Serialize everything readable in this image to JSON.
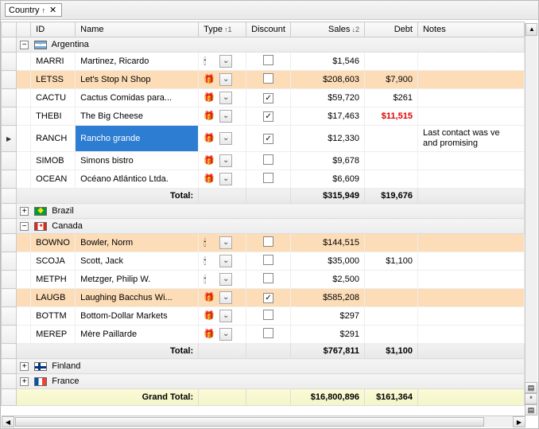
{
  "group_chip": {
    "label": "Country",
    "sort": "↑",
    "close": "✕"
  },
  "columns": {
    "id": "ID",
    "name": "Name",
    "type": "Type",
    "type_sort": "↑1",
    "discount": "Discount",
    "sales": "Sales",
    "sales_sort": "↓2",
    "debt": "Debt",
    "notes": "Notes"
  },
  "groups": [
    {
      "expanded": true,
      "flag": "ar",
      "country": "Argentina",
      "rows": [
        {
          "highlight": false,
          "selected": false,
          "indicator": false,
          "id": "MARRI",
          "name": "Martinez, Ricardo",
          "type": "single",
          "discount": false,
          "sales": "$1,546",
          "debt": "",
          "notes": "",
          "debt_red": false
        },
        {
          "highlight": true,
          "selected": false,
          "indicator": false,
          "id": "LETSS",
          "name": "Let's Stop N Shop",
          "type": "double",
          "discount": false,
          "sales": "$208,603",
          "debt": "$7,900",
          "notes": "",
          "debt_red": false
        },
        {
          "highlight": false,
          "selected": false,
          "indicator": false,
          "id": "CACTU",
          "name": "Cactus Comidas para...",
          "type": "double",
          "discount": true,
          "sales": "$59,720",
          "debt": "$261",
          "notes": "",
          "debt_red": false
        },
        {
          "highlight": false,
          "selected": false,
          "indicator": false,
          "id": "THEBI",
          "name": "The Big Cheese",
          "type": "double",
          "discount": true,
          "sales": "$17,463",
          "debt": "$11,515",
          "notes": "",
          "debt_red": true
        },
        {
          "highlight": false,
          "selected": true,
          "indicator": true,
          "id": "RANCH",
          "name": "Rancho grande",
          "type": "double",
          "discount": true,
          "sales": "$12,330",
          "debt": "",
          "notes": "Last contact was ve\nand promising",
          "debt_red": false
        },
        {
          "highlight": false,
          "selected": false,
          "indicator": false,
          "id": "SIMOB",
          "name": "Simons bistro",
          "type": "double",
          "discount": false,
          "sales": "$9,678",
          "debt": "",
          "notes": "",
          "debt_red": false
        },
        {
          "highlight": false,
          "selected": false,
          "indicator": false,
          "id": "OCEAN",
          "name": "Océano Atlántico Ltda.",
          "type": "double",
          "discount": false,
          "sales": "$6,609",
          "debt": "",
          "notes": "",
          "debt_red": false
        }
      ],
      "total": {
        "label": "Total:",
        "sales": "$315,949",
        "debt": "$19,676"
      }
    },
    {
      "expanded": false,
      "flag": "br",
      "country": "Brazil",
      "rows": [],
      "total": null
    },
    {
      "expanded": true,
      "flag": "ca",
      "country": "Canada",
      "rows": [
        {
          "highlight": true,
          "selected": false,
          "indicator": false,
          "id": "BOWNO",
          "name": "Bowler, Norm",
          "type": "single",
          "discount": false,
          "sales": "$144,515",
          "debt": "",
          "notes": "",
          "debt_red": false
        },
        {
          "highlight": false,
          "selected": false,
          "indicator": false,
          "id": "SCOJA",
          "name": "Scott, Jack",
          "type": "single",
          "discount": false,
          "sales": "$35,000",
          "debt": "$1,100",
          "notes": "",
          "debt_red": false
        },
        {
          "highlight": false,
          "selected": false,
          "indicator": false,
          "id": "METPH",
          "name": "Metzger, Philip W.",
          "type": "single",
          "discount": false,
          "sales": "$2,500",
          "debt": "",
          "notes": "",
          "debt_red": false
        },
        {
          "highlight": true,
          "selected": false,
          "indicator": false,
          "id": "LAUGB",
          "name": "Laughing Bacchus Wi...",
          "type": "double",
          "discount": true,
          "sales": "$585,208",
          "debt": "",
          "notes": "",
          "debt_red": false
        },
        {
          "highlight": false,
          "selected": false,
          "indicator": false,
          "id": "BOTTM",
          "name": "Bottom-Dollar Markets",
          "type": "double",
          "discount": false,
          "sales": "$297",
          "debt": "",
          "notes": "",
          "debt_red": false
        },
        {
          "highlight": false,
          "selected": false,
          "indicator": false,
          "id": "MEREP",
          "name": "Mère Paillarde",
          "type": "double",
          "discount": false,
          "sales": "$291",
          "debt": "",
          "notes": "",
          "debt_red": false
        }
      ],
      "total": {
        "label": "Total:",
        "sales": "$767,811",
        "debt": "$1,100"
      }
    },
    {
      "expanded": false,
      "flag": "fi",
      "country": "Finland",
      "rows": [],
      "total": null
    },
    {
      "expanded": false,
      "flag": "fr",
      "country": "France",
      "rows": [],
      "total": null
    }
  ],
  "grand": {
    "label": "Grand Total:",
    "sales": "$16,800,896",
    "debt": "$161,364"
  },
  "mini_buttons": {
    "a": "▤",
    "b": "*",
    "c": "▤"
  }
}
